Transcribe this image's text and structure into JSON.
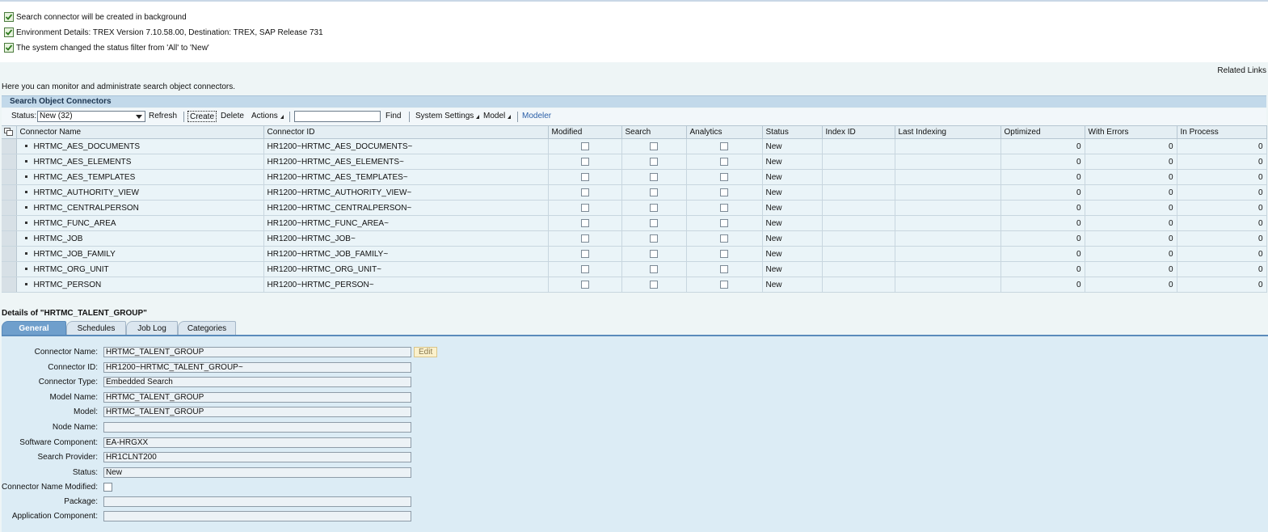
{
  "messages": [
    "Search connector will be created in background",
    "Environment Details: TREX Version 7.10.58.00, Destination: TREX, SAP Release 731",
    "The system changed the status filter from 'All' to 'New'"
  ],
  "related_links": "Related Links",
  "intro": "Here you can monitor and administrate search object connectors.",
  "tray_title": "Search Object Connectors",
  "toolbar": {
    "status_label": "Status:",
    "status_value": "New (32)",
    "refresh": "Refresh",
    "create": "Create",
    "delete": "Delete",
    "actions": "Actions",
    "find": "Find",
    "system_settings": "System Settings",
    "model": "Model",
    "modeler": "Modeler"
  },
  "columns": [
    "Connector Name",
    "Connector ID",
    "Modified",
    "Search",
    "Analytics",
    "Status",
    "Index ID",
    "Last Indexing",
    "Optimized",
    "With Errors",
    "In Process"
  ],
  "rows": [
    {
      "name": "HRTMC_AES_DOCUMENTS",
      "id": "HR1200~HRTMC_AES_DOCUMENTS~",
      "status": "New",
      "index_id": "",
      "last": "",
      "optimized": "0",
      "errors": "0",
      "inprocess": "0"
    },
    {
      "name": "HRTMC_AES_ELEMENTS",
      "id": "HR1200~HRTMC_AES_ELEMENTS~",
      "status": "New",
      "index_id": "",
      "last": "",
      "optimized": "0",
      "errors": "0",
      "inprocess": "0"
    },
    {
      "name": "HRTMC_AES_TEMPLATES",
      "id": "HR1200~HRTMC_AES_TEMPLATES~",
      "status": "New",
      "index_id": "",
      "last": "",
      "optimized": "0",
      "errors": "0",
      "inprocess": "0"
    },
    {
      "name": "HRTMC_AUTHORITY_VIEW",
      "id": "HR1200~HRTMC_AUTHORITY_VIEW~",
      "status": "New",
      "index_id": "",
      "last": "",
      "optimized": "0",
      "errors": "0",
      "inprocess": "0"
    },
    {
      "name": "HRTMC_CENTRALPERSON",
      "id": "HR1200~HRTMC_CENTRALPERSON~",
      "status": "New",
      "index_id": "",
      "last": "",
      "optimized": "0",
      "errors": "0",
      "inprocess": "0"
    },
    {
      "name": "HRTMC_FUNC_AREA",
      "id": "HR1200~HRTMC_FUNC_AREA~",
      "status": "New",
      "index_id": "",
      "last": "",
      "optimized": "0",
      "errors": "0",
      "inprocess": "0"
    },
    {
      "name": "HRTMC_JOB",
      "id": "HR1200~HRTMC_JOB~",
      "status": "New",
      "index_id": "",
      "last": "",
      "optimized": "0",
      "errors": "0",
      "inprocess": "0"
    },
    {
      "name": "HRTMC_JOB_FAMILY",
      "id": "HR1200~HRTMC_JOB_FAMILY~",
      "status": "New",
      "index_id": "",
      "last": "",
      "optimized": "0",
      "errors": "0",
      "inprocess": "0"
    },
    {
      "name": "HRTMC_ORG_UNIT",
      "id": "HR1200~HRTMC_ORG_UNIT~",
      "status": "New",
      "index_id": "",
      "last": "",
      "optimized": "0",
      "errors": "0",
      "inprocess": "0"
    },
    {
      "name": "HRTMC_PERSON",
      "id": "HR1200~HRTMC_PERSON~",
      "status": "New",
      "index_id": "",
      "last": "",
      "optimized": "0",
      "errors": "0",
      "inprocess": "0"
    }
  ],
  "details_title": "Details of \"HRTMC_TALENT_GROUP\"",
  "tabs": [
    "General",
    "Schedules",
    "Job Log",
    "Categories"
  ],
  "edit_label": "Edit",
  "fields": [
    {
      "label": "Connector Name:",
      "value": "HRTMC_TALENT_GROUP"
    },
    {
      "label": "Connector ID:",
      "value": "HR1200~HRTMC_TALENT_GROUP~"
    },
    {
      "label": "Connector Type:",
      "value": "Embedded Search"
    },
    {
      "label": "Model Name:",
      "value": "HRTMC_TALENT_GROUP"
    },
    {
      "label": "Model:",
      "value": "HRTMC_TALENT_GROUP"
    },
    {
      "label": "Node Name:",
      "value": ""
    },
    {
      "label": "Software Component:",
      "value": "EA-HRGXX"
    },
    {
      "label": "Search Provider:",
      "value": "HR1CLNT200"
    },
    {
      "label": "Status:",
      "value": "New"
    },
    {
      "label": "Connector Name Modified:",
      "value": ""
    },
    {
      "label": "Package:",
      "value": ""
    },
    {
      "label": "Application Component:",
      "value": ""
    }
  ]
}
